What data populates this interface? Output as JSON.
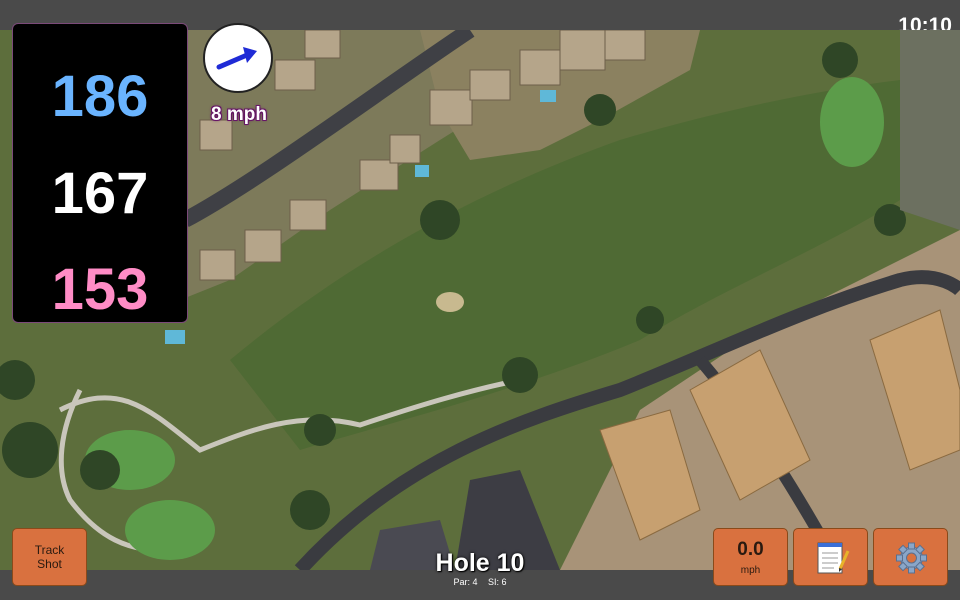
{
  "status": {
    "time": "10:10"
  },
  "yardage": {
    "back": "186",
    "middle": "167",
    "front": "153"
  },
  "wind": {
    "speed": "8 mph",
    "icon": "wind-arrow-icon"
  },
  "hole": {
    "title": "Hole 10",
    "par_label": "Par: 4",
    "si_label": "SI: 6"
  },
  "buttons": {
    "track_shot_line1": "Track",
    "track_shot_line2": "Shot",
    "speed_value": "0.0",
    "speed_unit": "mph",
    "notes_icon": "notepad-icon",
    "settings_icon": "gear-icon"
  },
  "colors": {
    "back_yardage": "#6ab4ff",
    "middle_yardage": "#ffffff",
    "front_yardage": "#ff8cc6",
    "button_orange": "#d9713f"
  }
}
